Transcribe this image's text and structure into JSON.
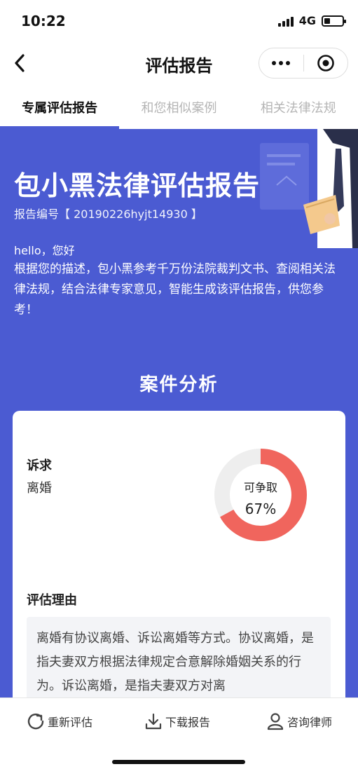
{
  "status_bar": {
    "time": "10:22",
    "network": "4G"
  },
  "nav": {
    "title": "评估报告"
  },
  "tabs": [
    {
      "label": "专属评估报告",
      "active": true
    },
    {
      "label": "和您相似案例",
      "active": false
    },
    {
      "label": "相关法律法规",
      "active": false
    }
  ],
  "hero": {
    "title": "包小黑法律评估报告",
    "report_number": "报告编号【 20190226hyjt14930 】",
    "greeting": "hello，您好",
    "intro": "根据您的描述，包小黑参考千万份法院裁判文书、查阅相关法律法规，结合法律专家意见，智能生成该评估报告，供您参考！"
  },
  "analysis": {
    "section_title": "案件分析",
    "claim_label": "诉求",
    "claim_value": "离婚",
    "gauge_label": "可争取",
    "gauge_value_text": "67%",
    "gauge_fraction": 0.67,
    "reason_label": "评估理由",
    "reason_text": "离婚有协议离婚、诉讼离婚等方式。协议离婚，是指夫妻双方根据法律规定合意解除婚姻关系的行为。诉讼离婚，是指夫妻双方对离"
  },
  "bottom_bar": {
    "reassess": "重新评估",
    "download": "下载报告",
    "consult": "咨询律师"
  },
  "colors": {
    "primary": "#4b5bd2",
    "gauge_fill": "#f0655d",
    "gauge_track": "#eeeeee"
  }
}
